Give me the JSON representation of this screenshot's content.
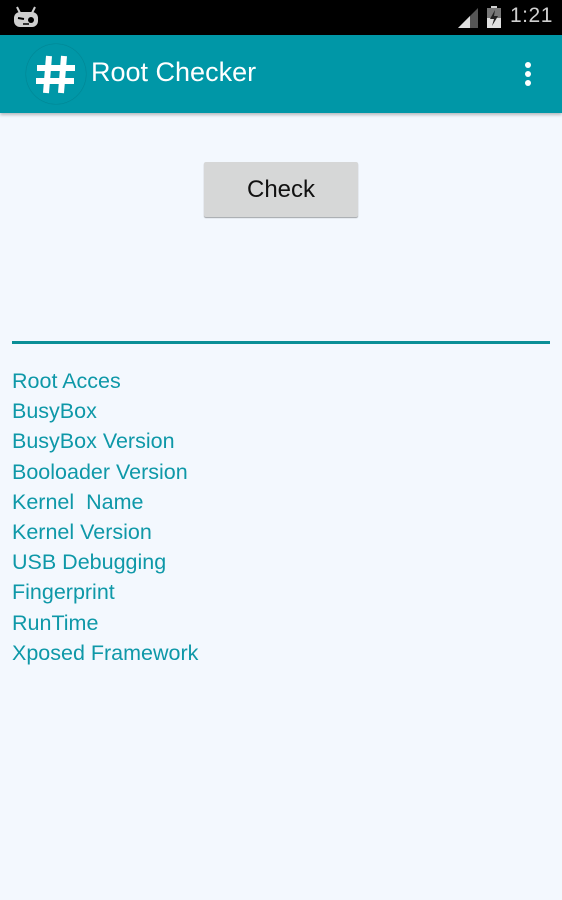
{
  "status_bar": {
    "time": "1:21",
    "icons": [
      "cyanogenmod-mascot-icon",
      "signal-icon",
      "battery-charging-icon"
    ]
  },
  "app_bar": {
    "title": "Root Checker",
    "logo_icon": "hash-icon",
    "menu_icon": "overflow-menu-icon"
  },
  "main": {
    "check_button_label": "Check",
    "info_items": [
      "Root Acces",
      "BusyBox",
      "BusyBox Version",
      "Booloader Version",
      "Kernel  Name",
      "Kernel Version",
      "USB Debugging",
      "Fingerprint",
      "RunTime",
      "Xposed Framework"
    ]
  },
  "colors": {
    "primary": "#0097a7",
    "accent_text": "#0e98a8",
    "background": "#f3f8fe",
    "button_bg": "#d6d7d7"
  }
}
